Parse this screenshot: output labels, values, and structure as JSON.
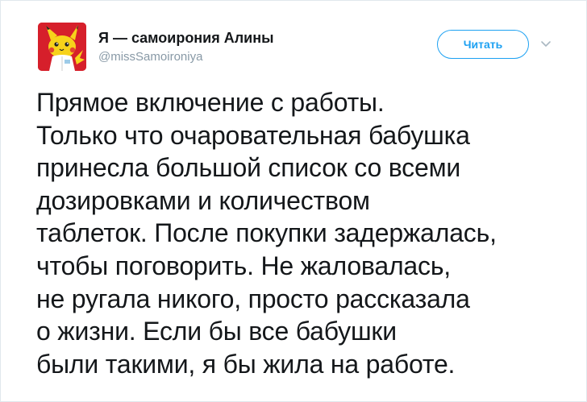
{
  "header": {
    "display_name": "Я — самоирония Алины",
    "handle": "@missSamoironiya",
    "follow_label": "Читать",
    "menu_icon": "chevron-down-icon"
  },
  "avatar": {
    "icon": "pikachu-avatar",
    "background": "#d61f2b"
  },
  "tweet": {
    "text": "Прямое включение с работы.\nТолько что очаровательная бабушка\nпринесла большой список со всеми\nдозировками и количеством\nтаблеток. После покупки задержалась,\nчтобы поговорить. Не жаловалась,\nне ругала никого, просто рассказала\nо жизни. Если бы все бабушки\nбыли такими, я бы жила на работе."
  },
  "colors": {
    "accent": "#1da1f2",
    "name": "#14171a",
    "handle": "#8899a6",
    "border": "#e1e8ed"
  }
}
